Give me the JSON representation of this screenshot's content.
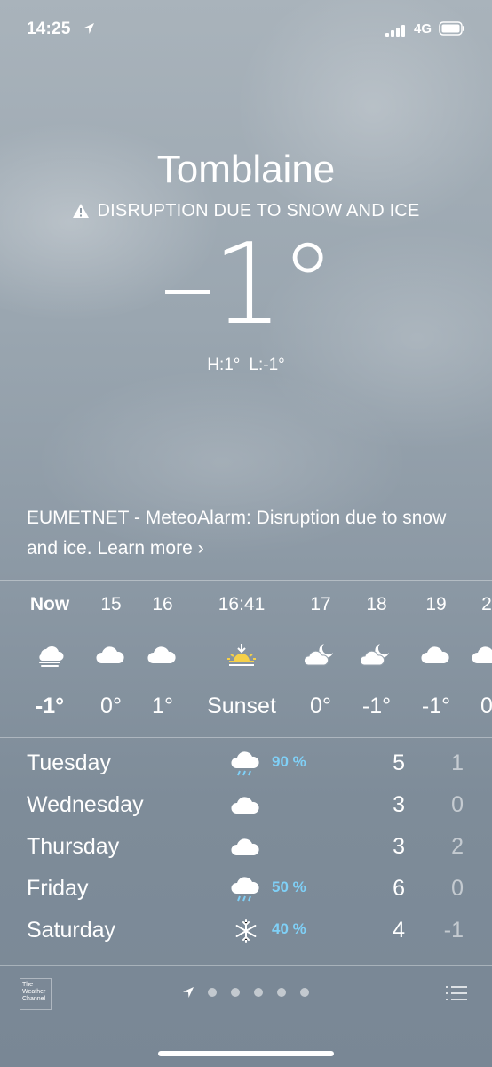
{
  "status": {
    "time": "14:25",
    "network": "4G"
  },
  "location": "Tomblaine",
  "alert_headline": "DISRUPTION DUE TO SNOW AND ICE",
  "current": {
    "temp": "–1°",
    "high": "H:1°",
    "low": "L:-1°"
  },
  "alert_text": "EUMETNET - MeteoAlarm: Disruption due to snow and ice. Learn more",
  "alert_more_glyph": "›",
  "hourly": [
    {
      "time": "Now",
      "icon": "fog-icon",
      "value": "-1°"
    },
    {
      "time": "15",
      "icon": "cloud-icon",
      "value": "0°"
    },
    {
      "time": "16",
      "icon": "cloud-icon",
      "value": "1°"
    },
    {
      "time": "16:41",
      "icon": "sunset-icon",
      "value": "Sunset"
    },
    {
      "time": "17",
      "icon": "cloud-moon-icon",
      "value": "0°"
    },
    {
      "time": "18",
      "icon": "cloud-moon-icon",
      "value": "-1°"
    },
    {
      "time": "19",
      "icon": "cloud-icon",
      "value": "-1°"
    },
    {
      "time": "2",
      "icon": "cloud-icon",
      "value": "0"
    }
  ],
  "daily": [
    {
      "day": "Tuesday",
      "icon": "rain-cloud-icon",
      "precip": "90 %",
      "high": "5",
      "low": "1"
    },
    {
      "day": "Wednesday",
      "icon": "cloud-icon",
      "precip": "",
      "high": "3",
      "low": "0"
    },
    {
      "day": "Thursday",
      "icon": "cloud-icon",
      "precip": "",
      "high": "3",
      "low": "2"
    },
    {
      "day": "Friday",
      "icon": "rain-cloud-icon",
      "precip": "50 %",
      "high": "6",
      "low": "0"
    },
    {
      "day": "Saturday",
      "icon": "snowflake-icon",
      "precip": "40 %",
      "high": "4",
      "low": "-1"
    }
  ],
  "footer": {
    "provider": "The Weather Channel",
    "pages": 6,
    "current_page": 0
  },
  "colors": {
    "precip": "#7fd0f7",
    "sun": "#f5d04a"
  }
}
